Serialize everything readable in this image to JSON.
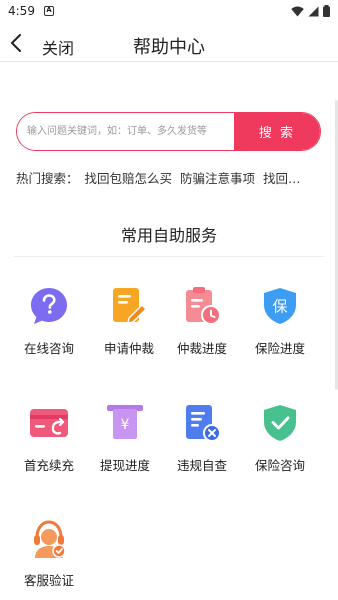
{
  "status_bar": {
    "time": "4:59",
    "badge": "A"
  },
  "header": {
    "close_label": "关闭",
    "title": "帮助中心"
  },
  "search": {
    "placeholder": "输入问题关键词，如：订单、多久发货等",
    "button_label": "搜 索"
  },
  "hot_search": {
    "label": "热门搜索：",
    "items": [
      "找回包赔怎么买",
      "防骗注意事项",
      "找回…"
    ]
  },
  "section_title": "常用自助服务",
  "services": [
    {
      "label": "在线咨询",
      "icon": "question-bubble-icon"
    },
    {
      "label": "申请仲裁",
      "icon": "document-edit-icon"
    },
    {
      "label": "仲裁进度",
      "icon": "clipboard-clock-icon"
    },
    {
      "label": "保险进度",
      "icon": "shield-bao-icon"
    },
    {
      "label": "首充续充",
      "icon": "card-refund-icon"
    },
    {
      "label": "提现进度",
      "icon": "yen-withdraw-icon"
    },
    {
      "label": "违规自查",
      "icon": "document-cross-icon"
    },
    {
      "label": "保险咨询",
      "icon": "shield-check-icon"
    },
    {
      "label": "客服验证",
      "icon": "customer-service-icon"
    }
  ],
  "colors": {
    "accent": "#ef3a5d",
    "purple": "#7b6cf0",
    "orange": "#f6a623",
    "pink": "#f58b93",
    "blue": "#3d9df2",
    "green": "#49c08f"
  }
}
